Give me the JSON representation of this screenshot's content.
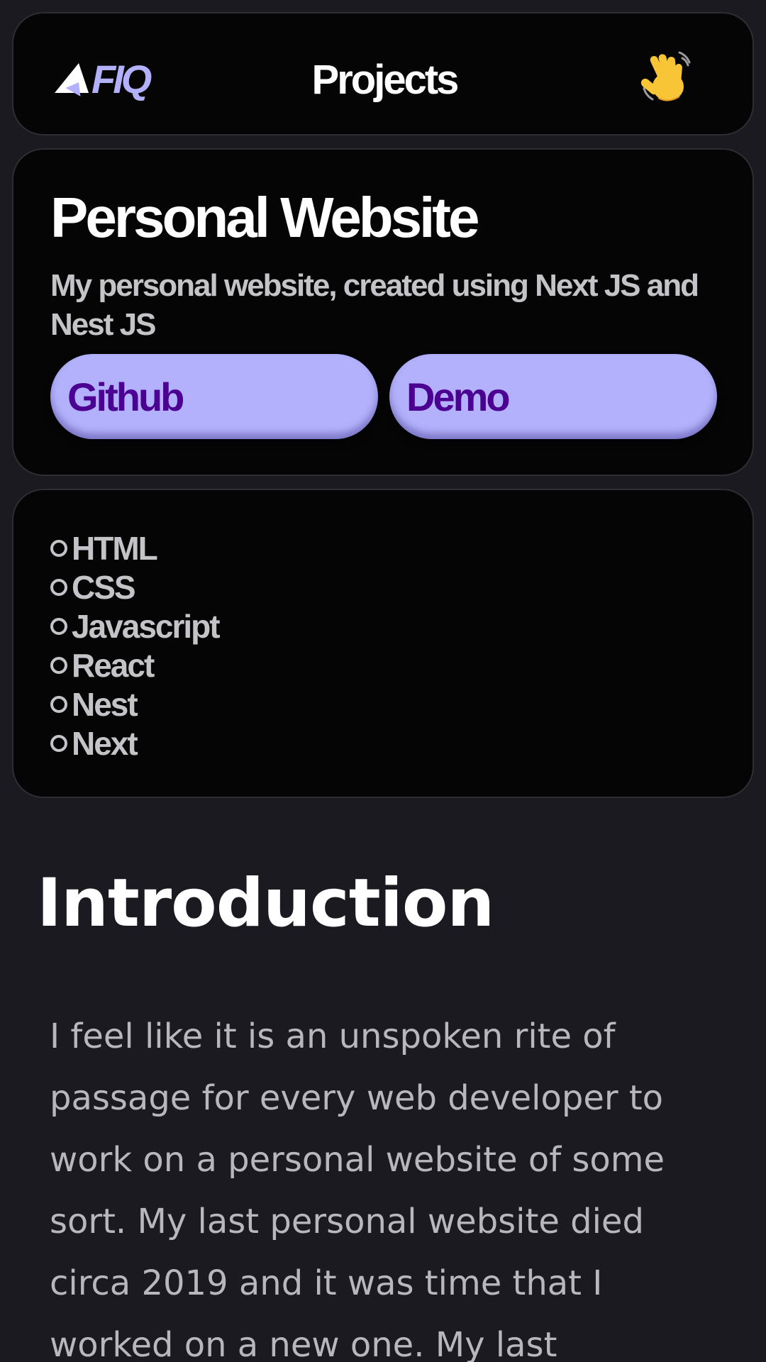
{
  "header": {
    "logo_text": "FIQ",
    "title": "Projects",
    "wave_icon": "waving-hand-icon"
  },
  "project": {
    "title": "Personal Website",
    "description": "My personal website, created using Next JS and Nest JS",
    "buttons": [
      {
        "label": "Github"
      },
      {
        "label": "Demo"
      }
    ]
  },
  "tech_stack": {
    "items": [
      "HTML",
      "CSS",
      "Javascript",
      "React",
      "Nest",
      "Next"
    ]
  },
  "article": {
    "heading": "Introduction",
    "body": "I feel like it is an unspoken rite of passage for every web developer to work on a personal website of some sort. My last personal website died circa 2019 and it was time that I worked on a new one. My last"
  },
  "colors": {
    "page_bg": "#1b1a20",
    "card_bg": "#050505",
    "accent": "#b3b1fb",
    "button_text": "#4b0092",
    "muted_text": "#c3c3c8"
  }
}
